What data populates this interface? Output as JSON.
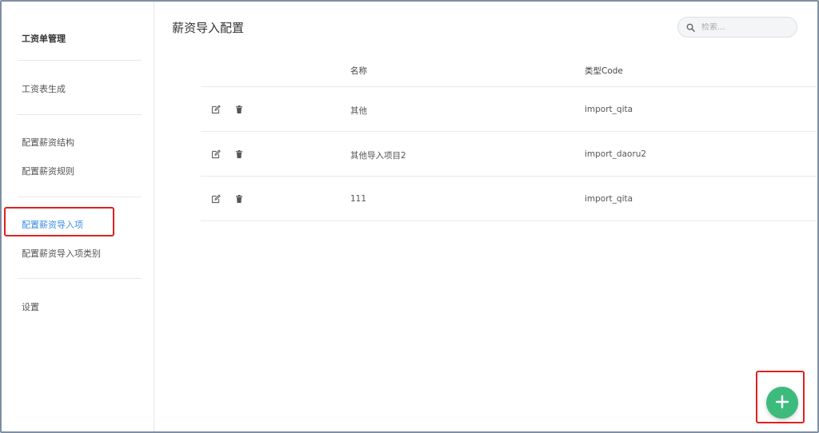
{
  "sidebar": {
    "title": "工资单管理",
    "items": [
      {
        "label": "工资表生成"
      },
      {
        "label": "配置薪资结构"
      },
      {
        "label": "配置薪资规则"
      },
      {
        "label": "配置薪资导入项"
      },
      {
        "label": "配置薪资导入项类别"
      },
      {
        "label": "设置"
      }
    ],
    "active_index": 3
  },
  "main": {
    "title": "薪资导入配置",
    "search": {
      "placeholder": "检索...",
      "value": ""
    },
    "table": {
      "columns": [
        "名称",
        "类型Code"
      ],
      "rows": [
        {
          "name": "其他",
          "code": "import_qita"
        },
        {
          "name": "其他导入项目2",
          "code": "import_daoru2"
        },
        {
          "name": "111",
          "code": "import_qita"
        }
      ]
    }
  },
  "icons": {
    "edit": "edit-icon",
    "delete": "trash-icon",
    "search": "search-icon",
    "add": "plus-icon"
  },
  "colors": {
    "accent": "#3a8ee6",
    "fab": "#3dbb7c",
    "highlight": "#e02020"
  }
}
